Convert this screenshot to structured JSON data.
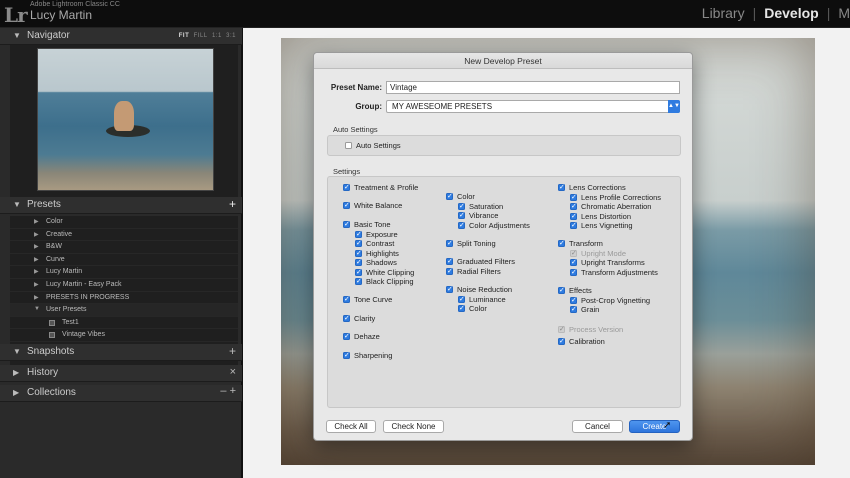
{
  "topbar": {
    "logo": "Lr",
    "app_name": "Adobe Lightroom Classic CC",
    "user_name": "Lucy Martin",
    "modules": [
      "Library",
      "Develop",
      "M"
    ],
    "active_module": "Develop"
  },
  "navigator": {
    "title": "Navigator",
    "zoom_fit": "FIT",
    "zoom_fill": "FILL",
    "zoom_1": "1:1",
    "zoom_3": "3:1"
  },
  "presets": {
    "title": "Presets",
    "add": "+",
    "items": [
      "Color",
      "Creative",
      "B&W",
      "Curve",
      "Lucy Martin",
      "Lucy Martin - Easy Pack",
      "PRESETS IN PROGRESS",
      "User Presets"
    ],
    "user_presets_children": [
      "Test1",
      "Vintage Vibes"
    ]
  },
  "panels": {
    "snapshots": "Snapshots",
    "snapshots_action": "+",
    "history": "History",
    "history_action": "×",
    "collections": "Collections",
    "collections_action": "– +"
  },
  "dialog": {
    "title": "New Develop Preset",
    "preset_name_label": "Preset Name:",
    "preset_name_value": "Vintage",
    "group_label": "Group:",
    "group_value": "MY AWESEOME PRESETS",
    "auto_settings_section": "Auto Settings",
    "auto_settings_checkbox": "Auto Settings",
    "settings_section": "Settings",
    "col1": [
      "Treatment & Profile",
      "White Balance",
      "Basic Tone",
      "Exposure",
      "Contrast",
      "Highlights",
      "Shadows",
      "White Clipping",
      "Black Clipping",
      "Tone Curve",
      "Clarity",
      "Dehaze",
      "Sharpening"
    ],
    "col2": [
      "Color",
      "Saturation",
      "Vibrance",
      "Color Adjustments",
      "Split Toning",
      "Graduated Filters",
      "Radial Filters",
      "Noise Reduction",
      "Luminance",
      "Color"
    ],
    "col3": [
      "Lens Corrections",
      "Lens Profile Corrections",
      "Chromatic Aberration",
      "Lens Distortion",
      "Lens Vignetting",
      "Transform",
      "Upright Mode",
      "Upright Transforms",
      "Transform Adjustments",
      "Effects",
      "Post-Crop Vignetting",
      "Grain",
      "Process Version",
      "Calibration"
    ],
    "check_all": "Check All",
    "check_none": "Check None",
    "cancel": "Cancel",
    "create": "Create"
  },
  "colors": {
    "accent": "#2e7be0",
    "panel_bg": "#2a2a2a",
    "dialog_bg": "#e8e8e8"
  }
}
